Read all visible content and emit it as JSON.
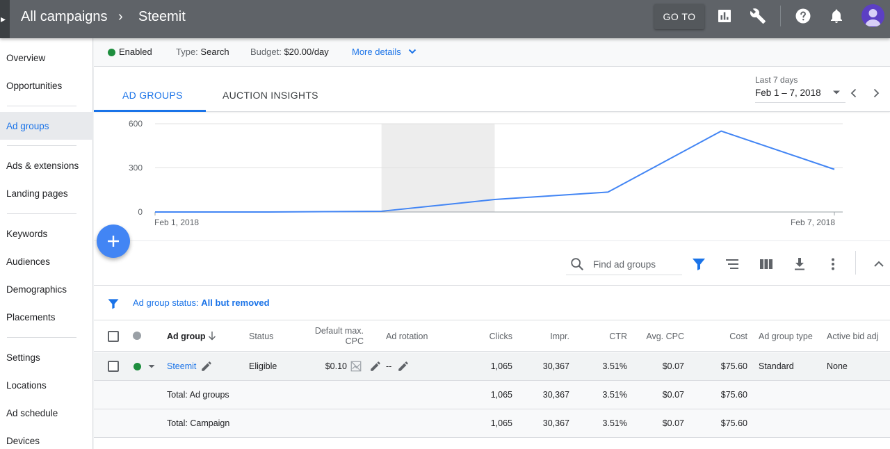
{
  "header": {
    "breadcrumb_root": "All campaigns",
    "breadcrumb_separator": "›",
    "breadcrumb_current": "Steemit",
    "goto_label": "GO TO"
  },
  "sidebar": {
    "items": [
      {
        "label": "Overview"
      },
      {
        "label": "Opportunities"
      },
      {
        "label": "Ad groups",
        "active": true
      },
      {
        "label": "Ads & extensions"
      },
      {
        "label": "Landing pages"
      },
      {
        "label": "Keywords"
      },
      {
        "label": "Audiences"
      },
      {
        "label": "Demographics"
      },
      {
        "label": "Placements"
      },
      {
        "label": "Settings"
      },
      {
        "label": "Locations"
      },
      {
        "label": "Ad schedule"
      },
      {
        "label": "Devices"
      }
    ]
  },
  "status_bar": {
    "status": "Enabled",
    "type_label": "Type:",
    "type_value": "Search",
    "budget_label": "Budget:",
    "budget_value": "$20.00/day",
    "more_details": "More details"
  },
  "tabs": [
    {
      "label": "AD GROUPS",
      "active": true
    },
    {
      "label": "AUCTION INSIGHTS",
      "active": false
    }
  ],
  "date_picker": {
    "label": "Last 7 days",
    "range": "Feb 1 – 7, 2018"
  },
  "chart_data": {
    "type": "line",
    "x": [
      "Feb 1, 2018",
      "Feb 2, 2018",
      "Feb 3, 2018",
      "Feb 4, 2018",
      "Feb 5, 2018",
      "Feb 6, 2018",
      "Feb 7, 2018"
    ],
    "x_tick_labels": [
      "Feb 1, 2018",
      "Feb 7, 2018"
    ],
    "series": [
      {
        "values": [
          0,
          0,
          5,
          85,
          135,
          550,
          290
        ],
        "color": "#4285f4"
      }
    ],
    "y_ticks": [
      0,
      300,
      600
    ],
    "ylim": [
      0,
      600
    ],
    "highlight_range": [
      "Feb 3, 2018",
      "Feb 4, 2018"
    ],
    "grid": true
  },
  "toolbar": {
    "search_placeholder": "Find ad groups"
  },
  "filter": {
    "label": "Ad group status:",
    "value": "All but removed"
  },
  "table": {
    "headers": {
      "ad_group": "Ad group",
      "status": "Status",
      "default_max_cpc_line1": "Default max.",
      "default_max_cpc_line2": "CPC",
      "ad_rotation": "Ad rotation",
      "clicks": "Clicks",
      "impr": "Impr.",
      "ctr": "CTR",
      "avg_cpc": "Avg. CPC",
      "cost": "Cost",
      "ad_group_type": "Ad group type",
      "active_bid_adj": "Active bid adj"
    },
    "rows": [
      {
        "ad_group": "Steemit",
        "status": "Eligible",
        "default_max_cpc": "$0.10",
        "ad_rotation": "--",
        "clicks": "1,065",
        "impr": "30,367",
        "ctr": "3.51%",
        "avg_cpc": "$0.07",
        "cost": "$75.60",
        "ad_group_type": "Standard",
        "active_bid_adj": "None"
      }
    ],
    "totals": [
      {
        "label": "Total: Ad groups",
        "clicks": "1,065",
        "impr": "30,367",
        "ctr": "3.51%",
        "avg_cpc": "$0.07",
        "cost": "$75.60"
      },
      {
        "label": "Total: Campaign",
        "clicks": "1,065",
        "impr": "30,367",
        "ctr": "3.51%",
        "avg_cpc": "$0.07",
        "cost": "$75.60"
      }
    ]
  }
}
